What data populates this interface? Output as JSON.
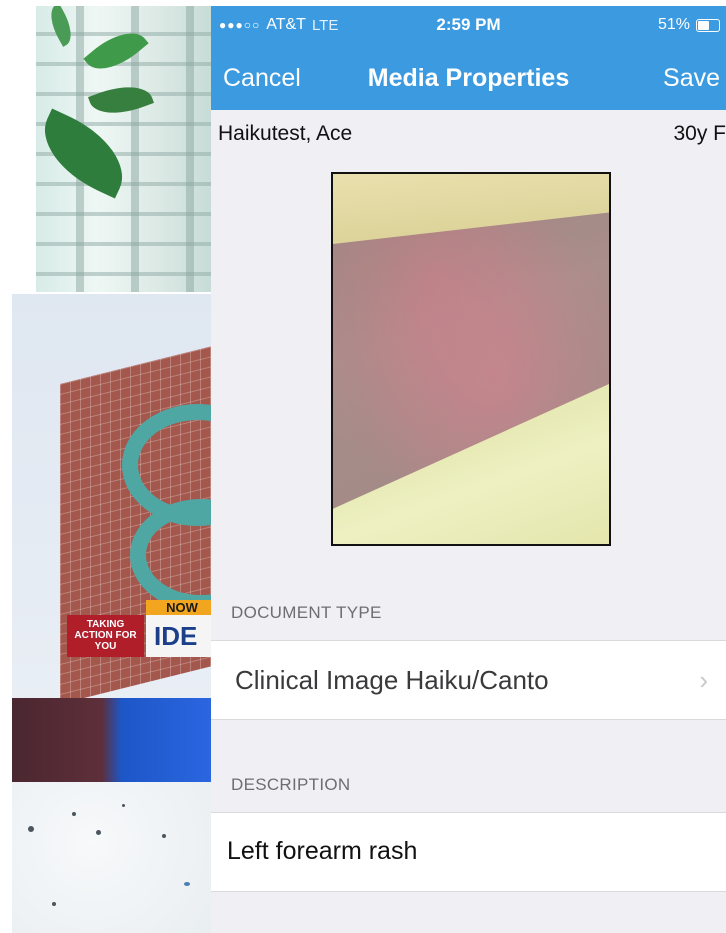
{
  "status_bar": {
    "signal": "●●●○○",
    "carrier": "AT&T",
    "network": "LTE",
    "time": "2:59 PM",
    "battery": "51%"
  },
  "nav": {
    "cancel": "Cancel",
    "title": "Media Properties",
    "save": "Save"
  },
  "patient": {
    "name": "Haikutest, Ace",
    "age_sex": "30y F"
  },
  "background_collage": {
    "news_now": "NOW",
    "news_taking": "TAKING ACTION FOR YOU",
    "news_id": "IDE"
  },
  "document_type": {
    "header": "DOCUMENT TYPE",
    "value": "Clinical Image Haiku/Canto",
    "chevron": "›"
  },
  "description": {
    "header": "DESCRIPTION",
    "value": "Left forearm rash"
  },
  "colors": {
    "nav_blue": "#3c9be0",
    "grouped_bg": "#efeff4",
    "section_text": "#6d6d72"
  }
}
